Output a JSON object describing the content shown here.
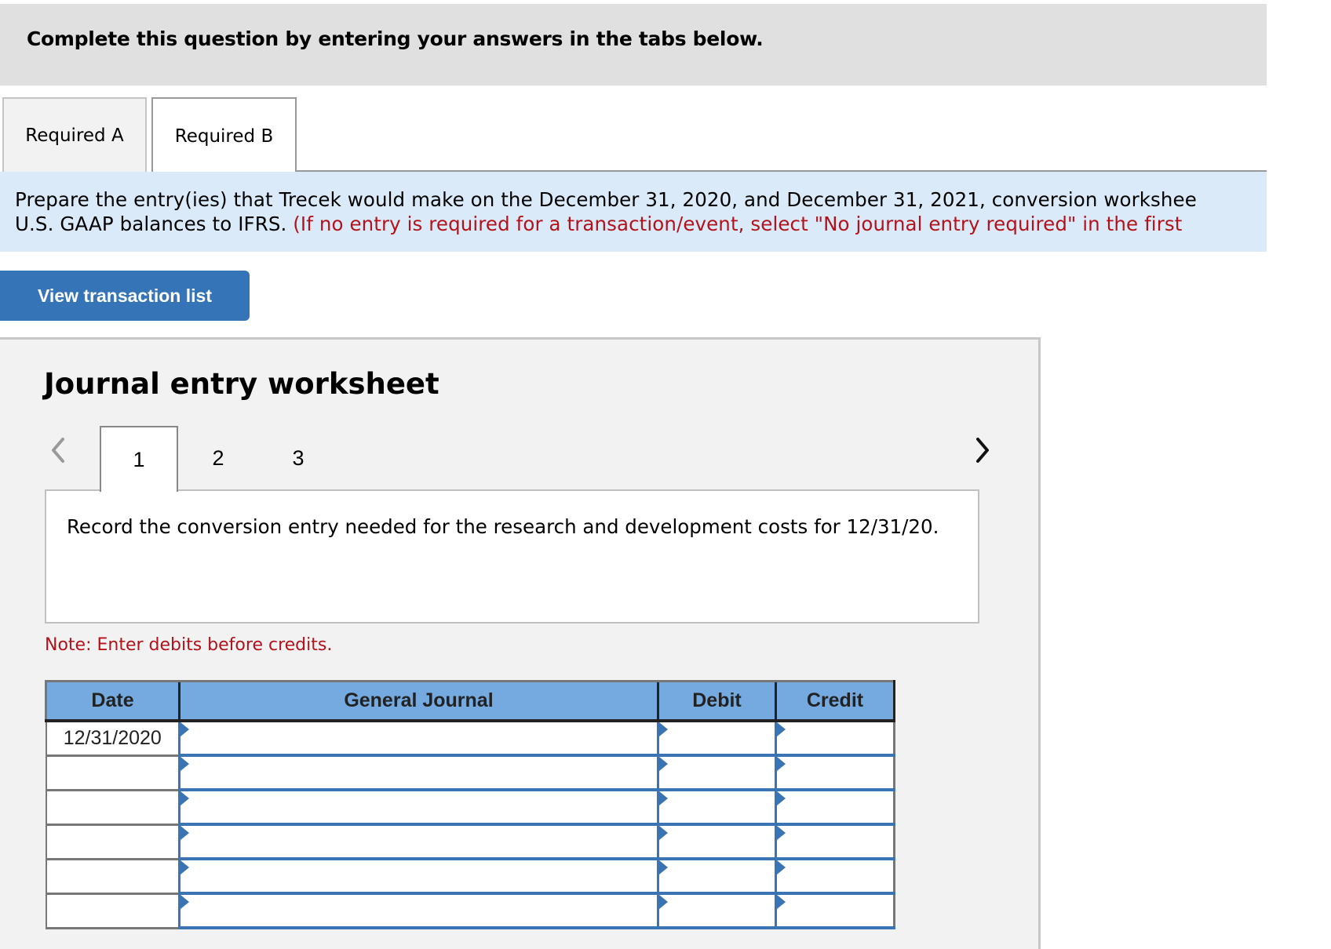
{
  "header": {
    "instruction": "Complete this question by entering your answers in the tabs below."
  },
  "tabs": [
    {
      "label": "Required A",
      "active": false
    },
    {
      "label": "Required B",
      "active": true
    }
  ],
  "instructions": {
    "line1": "Prepare the entry(ies) that Trecek would make on the December 31, 2020, and December 31, 2021, conversion workshee",
    "line2_black": "U.S. GAAP balances to IFRS. ",
    "line2_red": "(If no entry is required for a transaction/event, select \"No journal entry required\" in the first"
  },
  "view_transaction_button": "View transaction list",
  "worksheet": {
    "title": "Journal entry worksheet",
    "pager": {
      "prev_icon": "chevron-left-icon",
      "next_icon": "chevron-right-icon",
      "pages": [
        "1",
        "2",
        "3"
      ],
      "active_page": "1"
    },
    "description": "Record the conversion entry needed for the research and development costs for 12/31/20.",
    "note": "Note: Enter debits before credits.",
    "table": {
      "columns": [
        "Date",
        "General Journal",
        "Debit",
        "Credit"
      ],
      "rows": [
        {
          "date": "12/31/2020",
          "account": "",
          "debit": "",
          "credit": ""
        },
        {
          "date": "",
          "account": "",
          "debit": "",
          "credit": ""
        },
        {
          "date": "",
          "account": "",
          "debit": "",
          "credit": ""
        },
        {
          "date": "",
          "account": "",
          "debit": "",
          "credit": ""
        },
        {
          "date": "",
          "account": "",
          "debit": "",
          "credit": ""
        },
        {
          "date": "",
          "account": "",
          "debit": "",
          "credit": ""
        }
      ]
    }
  },
  "colors": {
    "accent_blue": "#3575b7",
    "header_blue": "#75aae0",
    "instruction_bg": "#dbeaf8",
    "warning_red": "#b3121b"
  }
}
